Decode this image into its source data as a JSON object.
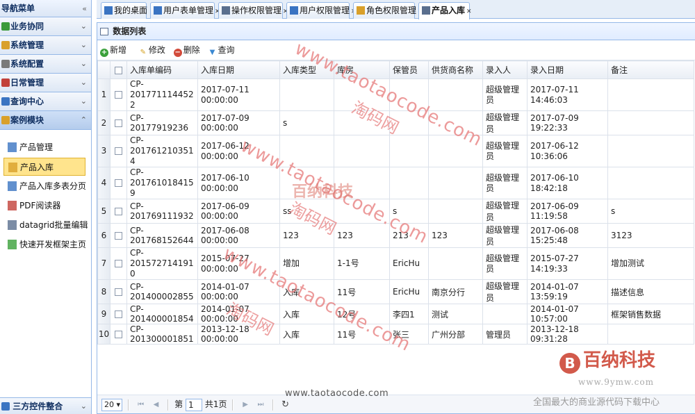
{
  "sidebar": {
    "header": "导航菜单",
    "groups": [
      {
        "label": "业务协同",
        "icon": "people-icon",
        "color": "#3a9a3a"
      },
      {
        "label": "系统管理",
        "icon": "gear-icon",
        "color": "#d9a02a"
      },
      {
        "label": "系统配置",
        "icon": "wrench-icon",
        "color": "#7a7a7a"
      },
      {
        "label": "日常管理",
        "icon": "calendar-icon",
        "color": "#c2413a"
      },
      {
        "label": "查询中心",
        "icon": "search-icon",
        "color": "#3a74c2"
      },
      {
        "label": "案例模块",
        "icon": "folder-icon",
        "color": "#d9a02a"
      }
    ],
    "items": [
      {
        "label": "产品管理",
        "icon": "grid-icon"
      },
      {
        "label": "产品入库",
        "icon": "form-icon"
      },
      {
        "label": "产品入库多表分页",
        "icon": "table-icon"
      },
      {
        "label": "PDF阅读器",
        "icon": "pdf-icon"
      },
      {
        "label": "datagrid批量编辑",
        "icon": "edit-grid-icon"
      },
      {
        "label": "快速开发框架主页",
        "icon": "gear-icon"
      }
    ],
    "bottom": "三方控件整合"
  },
  "tabs": [
    {
      "label": "我的桌面",
      "closable": false
    },
    {
      "label": "用户表单管理",
      "closable": true
    },
    {
      "label": "操作权限管理",
      "closable": true
    },
    {
      "label": "用户权限管理",
      "closable": true
    },
    {
      "label": "角色权限管理",
      "closable": true
    },
    {
      "label": "产品入库",
      "closable": true
    }
  ],
  "panel": {
    "title": "数据列表",
    "toolbar": {
      "add": "新增",
      "edit": "修改",
      "delete": "删除",
      "query": "查询"
    }
  },
  "grid": {
    "columns": [
      "入库单编码",
      "入库日期",
      "入库类型",
      "库房",
      "保管员",
      "供货商名称",
      "录入人",
      "录入日期",
      "备注"
    ],
    "rows": [
      {
        "n": "1",
        "code": "CP-2017711144522",
        "date": "2017-07-11 00:00:00",
        "type": "",
        "store": "",
        "keeper": "",
        "supplier": "",
        "entry": "超级管理员",
        "edate": "2017-07-11 14:46:03",
        "note": ""
      },
      {
        "n": "2",
        "code": "CP-20177919236",
        "date": "2017-07-09 00:00:00",
        "type": "s",
        "store": "",
        "keeper": "",
        "supplier": "",
        "entry": "超级管理员",
        "edate": "2017-07-09 19:22:33",
        "note": ""
      },
      {
        "n": "3",
        "code": "CP-2017612103514",
        "date": "2017-06-12 00:00:00",
        "type": "",
        "store": "",
        "keeper": "",
        "supplier": "",
        "entry": "超级管理员",
        "edate": "2017-06-12 10:36:06",
        "note": ""
      },
      {
        "n": "4",
        "code": "CP-2017610184159",
        "date": "2017-06-10 00:00:00",
        "type": "",
        "store": "",
        "keeper": "",
        "supplier": "",
        "entry": "超级管理员",
        "edate": "2017-06-10 18:42:18",
        "note": ""
      },
      {
        "n": "5",
        "code": "CP-201769111932",
        "date": "2017-06-09 00:00:00",
        "type": "ss",
        "store": "",
        "keeper": "s",
        "supplier": "",
        "entry": "超级管理员",
        "edate": "2017-06-09 11:19:58",
        "note": "s"
      },
      {
        "n": "6",
        "code": "CP-201768152644",
        "date": "2017-06-08 00:00:00",
        "type": "123",
        "store": "123",
        "keeper": "213",
        "supplier": "123",
        "entry": "超级管理员",
        "edate": "2017-06-08 15:25:48",
        "note": "3123"
      },
      {
        "n": "7",
        "code": "CP-2015727141910",
        "date": "2015-07-27 00:00:00",
        "type": "增加",
        "store": "1-1号",
        "keeper": "EricHu",
        "supplier": "",
        "entry": "超级管理员",
        "edate": "2015-07-27 14:19:33",
        "note": "增加测试"
      },
      {
        "n": "8",
        "code": "CP-201400002855",
        "date": "2014-01-07 00:00:00",
        "type": "入库",
        "store": "11号",
        "keeper": "EricHu",
        "supplier": "南京分行",
        "entry": "超级管理员",
        "edate": "2014-01-07 13:59:19",
        "note": "描述信息"
      },
      {
        "n": "9",
        "code": "CP-201400001854",
        "date": "2014-01-07 00:00:00",
        "type": "入库",
        "store": "12号",
        "keeper": "李四1",
        "supplier": "测试",
        "entry": "",
        "edate": "2014-01-07 10:57:00",
        "note": "框架销售数据"
      },
      {
        "n": "10",
        "code": "CP-201300001851",
        "date": "2013-12-18 00:00:00",
        "type": "入库",
        "store": "11号",
        "keeper": "张三",
        "supplier": "广州分部",
        "entry": "管理员",
        "edate": "2013-12-18 09:31:28",
        "note": ""
      }
    ]
  },
  "pager": {
    "page_size": "20",
    "page_prefix": "第",
    "page_value": "1",
    "page_total": "共1页"
  },
  "watermarks": {
    "url": "www.taotaocode.com",
    "cn": "淘码网",
    "brand": "百纳科技",
    "brand_url": "www.9ymw.com",
    "slogan": "全国最大的商业源代码下载中心",
    "brand_color": "#d25a4b"
  },
  "colors": {
    "border": "#95b8e7",
    "selected": "#ffe48d",
    "add": "#3aa03a",
    "delete": "#d24a3a",
    "query": "#3a88d2"
  }
}
